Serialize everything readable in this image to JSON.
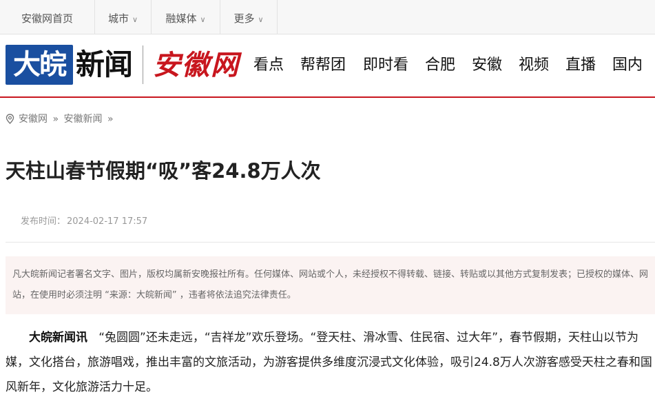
{
  "topbar": {
    "home": "安徽网首页",
    "city": "城市",
    "media": "融媒体",
    "more": "更多"
  },
  "header": {
    "logo_mark": "大皖",
    "logo_text": "新闻",
    "site_logo": "安徽网",
    "nav": [
      "看点",
      "帮帮团",
      "即时看",
      "合肥",
      "安徽",
      "视频",
      "直播",
      "国内"
    ]
  },
  "breadcrumb": {
    "items": [
      "安徽网",
      "安徽新闻"
    ],
    "sep": "»"
  },
  "article": {
    "title": "天柱山春节假期“吸”客24.8万人次",
    "pub_label": "发布时间：",
    "pub_time": "2024-02-17 17:57",
    "notice": "凡大皖新闻记者署名文字、图片，版权均属新安晚报社所有。任何媒体、网站或个人，未经授权不得转载、链接、转贴或以其他方式复制发表；已授权的媒体、网站，在使用时必须注明 “来源：大皖新闻” ，违者将依法追究法律责任。",
    "lead_source": "大皖新闻讯",
    "body": "“兔圆圆”还未走远，“吉祥龙”欢乐登场。“登天柱、滑冰雪、住民宿、过大年”，春节假期，天柱山以节为媒，文化搭台，旅游唱戏，推出丰富的文旅活动，为游客提供多维度沉浸式文化体验，吸引24.8万人次游客感受天柱之春和国风新年，文化旅游活力十足。"
  }
}
